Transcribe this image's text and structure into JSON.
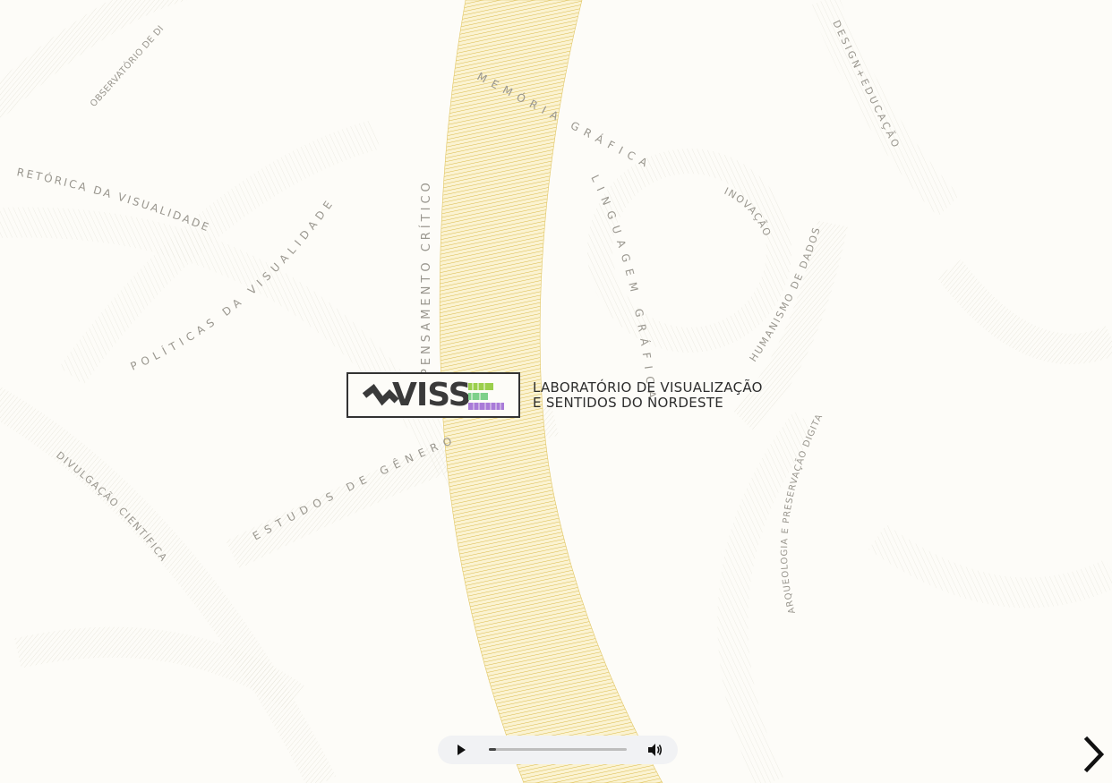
{
  "logo": {
    "word": "VISS",
    "alt": "VISSE logo"
  },
  "lab_title": {
    "line1": "LABORATÓRIO DE VISUALIZAÇÃO",
    "line2": "E SENTIDOS DO NORDESTE"
  },
  "keywords": [
    "OBSERVATÓRIO DE DI",
    "RETÓRICA DA VISUALIDADE",
    "POLÍTICAS DA VISUALIDADE",
    "PENSAMENTO CRÍTICO",
    "MEMÓRIA GRÁFICA",
    "LINGUAGEM GRÁFICA",
    "INOVAÇÃO",
    "HUMANISMO DE DADOS",
    "DESIGN+EDUCAÇÃO",
    "ESTUDOS DE GÊNERO",
    "DIVULGAÇÃO CIENTÍFICA",
    "ARQUEOLOGIA E PRESERVAÇÃO DIGITAL"
  ],
  "player": {
    "play_icon": "play-icon",
    "volume_icon": "volume-icon",
    "progress": 0.05
  },
  "navigation": {
    "next_icon": "chevron-right-icon"
  },
  "colors": {
    "accent_band": "#d9b83a",
    "text": "#2d2d2d",
    "keyword": "#9a978f",
    "background": "#fdfcf8"
  }
}
